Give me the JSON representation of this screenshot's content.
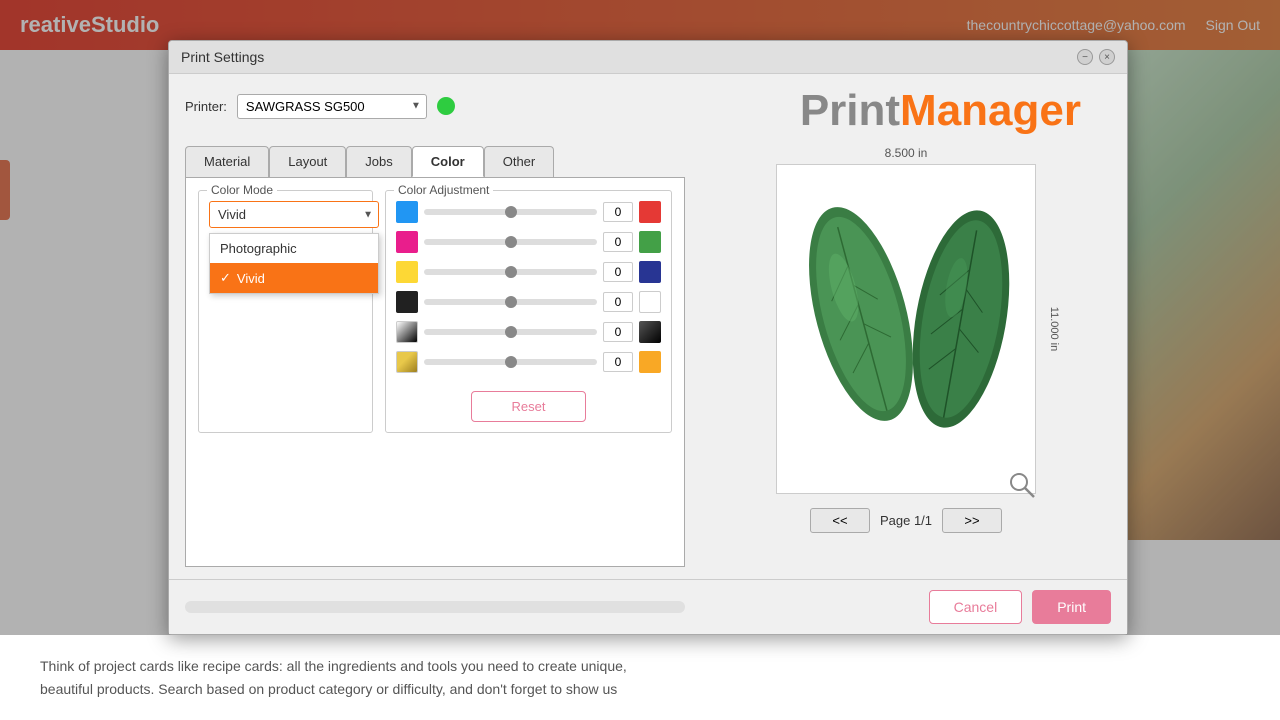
{
  "app": {
    "logo": "reativeStudio",
    "user_email": "thecountrychiccottage@yahoo.com",
    "sign_out": "Sign Out"
  },
  "dialog": {
    "title": "Print Settings",
    "printer_label": "Printer:",
    "printer_name": "SAWGRASS SG500",
    "printer_status_color": "#2ecc40",
    "print_manager_print": "Print",
    "print_manager_manager": "Manager",
    "tabs": [
      {
        "id": "material",
        "label": "Material"
      },
      {
        "id": "layout",
        "label": "Layout"
      },
      {
        "id": "jobs",
        "label": "Jobs"
      },
      {
        "id": "color",
        "label": "Color"
      },
      {
        "id": "other",
        "label": "Other"
      }
    ],
    "active_tab": "color",
    "color_mode": {
      "legend": "Color Mode",
      "current_value": "Vivid",
      "options": [
        {
          "value": "Photographic",
          "selected": false
        },
        {
          "value": "Vivid",
          "selected": true
        }
      ]
    },
    "color_adjustment": {
      "legend": "Color Adjustment",
      "rows": [
        {
          "left_color": "#2196f3",
          "value": "0",
          "right_color": "#e53935"
        },
        {
          "left_color": "#e91e8c",
          "value": "0",
          "right_color": "#43a047"
        },
        {
          "left_color": "#fdd835",
          "value": "0",
          "right_color": "#283593"
        },
        {
          "left_color": "#212121",
          "value": "0",
          "right_color": "#ffffff"
        },
        {
          "left_color": "#9e9e9e",
          "value": "0",
          "right_color": "#212121"
        },
        {
          "left_color": "#c8a84b",
          "value": "0",
          "right_color": "#f9a825"
        }
      ],
      "reset_label": "Reset"
    },
    "preview": {
      "width_label": "8.500 in",
      "height_label": "11.000 in",
      "page_prev": "<<",
      "page_next": ">>",
      "page_label": "Page 1/1"
    },
    "footer": {
      "cancel_label": "Cancel",
      "print_label": "Print"
    }
  },
  "background_text": {
    "line1": "Think of project cards like recipe cards: all the ingredients and tools you need to create unique,",
    "line2": "beautiful products. Search based on product category or difficulty, and don't forget to show us"
  }
}
